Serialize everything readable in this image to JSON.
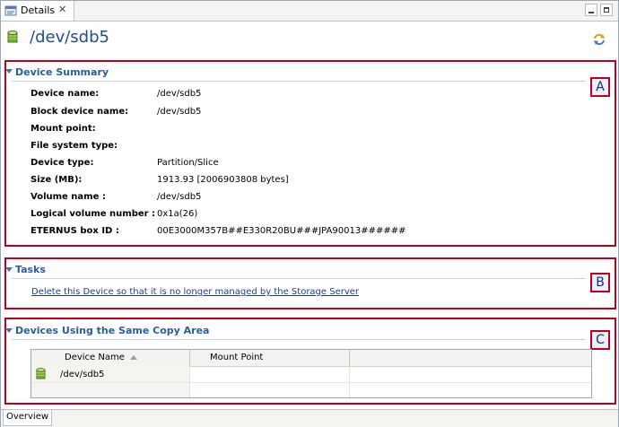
{
  "tab": {
    "label": "Details",
    "close_glyph": "✕"
  },
  "header": {
    "title": "/dev/sdb5"
  },
  "sections": {
    "summary": {
      "title": "Device Summary",
      "callout": "A",
      "rows": [
        {
          "label": "Device name:",
          "value": "/dev/sdb5"
        },
        {
          "label": "Block device name:",
          "value": "/dev/sdb5"
        },
        {
          "label": "Mount point:",
          "value": ""
        },
        {
          "label": "File system type:",
          "value": ""
        },
        {
          "label": "Device type:",
          "value": "Partition/Slice"
        },
        {
          "label": "Size (MB):",
          "value": "1913.93 [2006903808 bytes]"
        },
        {
          "label": "Volume name :",
          "value": "/dev/sdb5"
        },
        {
          "label": "Logical volume number :",
          "value": "0x1a(26)"
        },
        {
          "label": "ETERNUS box ID :",
          "value": "00E3000M357B##E330R20BU###JPA90013######"
        }
      ]
    },
    "tasks": {
      "title": "Tasks",
      "callout": "B",
      "link": "Delete this Device so that it is no longer managed by the Storage Server"
    },
    "copy_area": {
      "title": "Devices Using the Same Copy Area",
      "callout": "C",
      "columns": [
        "Device Name",
        "Mount Point"
      ],
      "rows": [
        {
          "device_name": "/dev/sdb5",
          "mount_point": ""
        }
      ]
    }
  },
  "bottom_tab": {
    "label": "Overview"
  },
  "icons": {
    "device": "database-icon",
    "refresh": "refresh-icon",
    "minimize": "minimize-icon",
    "maximize": "maximize-icon"
  },
  "colors": {
    "title_blue": "#1f4e8c",
    "section_blue": "#2a5c9e",
    "callout_red": "#c0001a",
    "link_blue": "#1f3d8c"
  }
}
